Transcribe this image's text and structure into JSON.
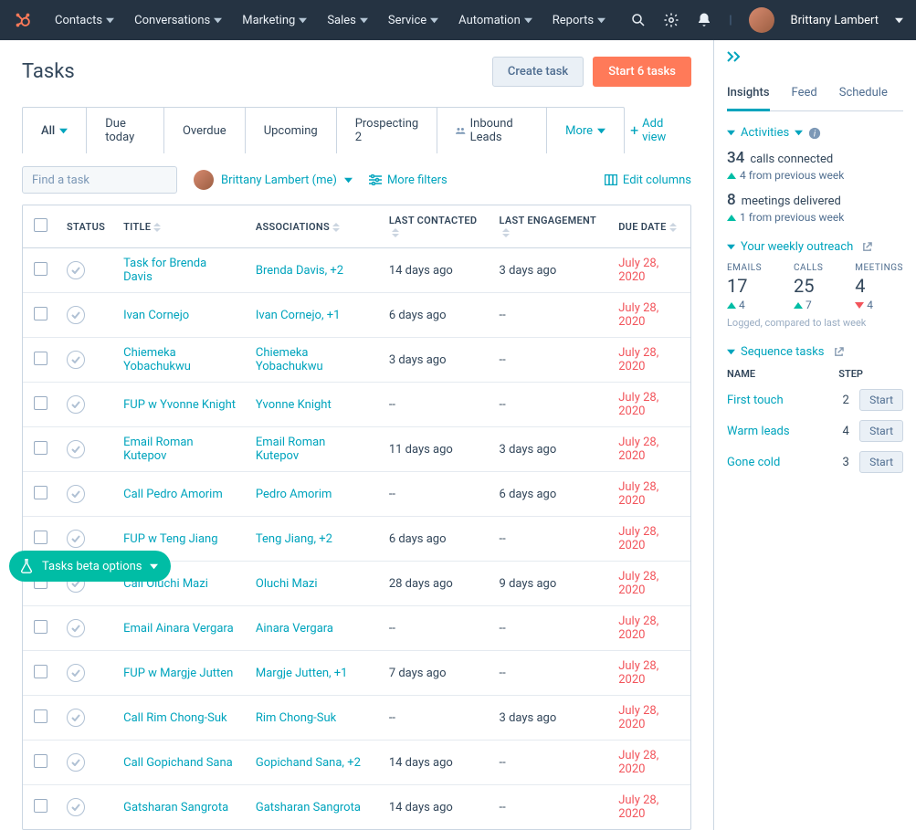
{
  "nav": {
    "items": [
      "Contacts",
      "Conversations",
      "Marketing",
      "Sales",
      "Service",
      "Automation",
      "Reports"
    ],
    "user_name": "Brittany Lambert"
  },
  "page": {
    "title": "Tasks",
    "create_btn": "Create task",
    "start_btn": "Start 6 tasks"
  },
  "tabs": {
    "items": [
      "All",
      "Due today",
      "Overdue",
      "Upcoming",
      "Prospecting 2",
      "Inbound Leads"
    ],
    "more": "More",
    "add_view": "Add view"
  },
  "toolbar": {
    "search_placeholder": "Find a task",
    "owner": "Brittany Lambert (me)",
    "more_filters": "More filters",
    "edit_cols": "Edit columns"
  },
  "table": {
    "headers": {
      "status": "STATUS",
      "title": "TITLE",
      "assoc": "ASSOCIATIONS",
      "lc": "LAST CONTACTED",
      "le": "LAST ENGAGEMENT",
      "due": "DUE DATE"
    },
    "rows": [
      {
        "title": "Task for Brenda Davis",
        "assoc": "Brenda Davis, +2",
        "lc": "14 days ago",
        "le": "3 days ago",
        "due": "July 28, 2020"
      },
      {
        "title": "Ivan Cornejo",
        "assoc": "Ivan Cornejo, +1",
        "lc": "6 days ago",
        "le": "--",
        "due": "July 28, 2020"
      },
      {
        "title": "Chiemeka Yobachukwu",
        "assoc": "Chiemeka Yobachukwu",
        "lc": "3 days ago",
        "le": "--",
        "due": "July 28, 2020"
      },
      {
        "title": "FUP w Yvonne Knight",
        "assoc": "Yvonne Knight",
        "lc": "--",
        "le": "--",
        "due": "July 28, 2020"
      },
      {
        "title": "Email Roman Kutepov",
        "assoc": "Email Roman Kutepov",
        "lc": "11 days ago",
        "le": "3 days ago",
        "due": "July 28, 2020"
      },
      {
        "title": "Call Pedro Amorim",
        "assoc": "Pedro Amorim",
        "lc": "--",
        "le": "6 days ago",
        "due": "July 28, 2020"
      },
      {
        "title": "FUP w Teng Jiang",
        "assoc": "Teng Jiang, +2",
        "lc": "6 days ago",
        "le": "--",
        "due": "July 28, 2020"
      },
      {
        "title": "Call Oluchi Mazi",
        "assoc": "Oluchi Mazi",
        "lc": "28 days ago",
        "le": "9 days ago",
        "due": "July 28, 2020"
      },
      {
        "title": "Email Ainara Vergara",
        "assoc": "Ainara Vergara",
        "lc": "--",
        "le": "--",
        "due": "July 28, 2020"
      },
      {
        "title": "FUP w Margje Jutten",
        "assoc": "Margje Jutten, +1",
        "lc": "7 days ago",
        "le": "--",
        "due": "July 28, 2020"
      },
      {
        "title": "Call Rim Chong-Suk",
        "assoc": "Rim Chong-Suk",
        "lc": "--",
        "le": "3 days ago",
        "due": "July 28, 2020"
      },
      {
        "title": "Call Gopichand Sana",
        "assoc": "Gopichand Sana, +2",
        "lc": "14 days ago",
        "le": "--",
        "due": "July 28, 2020"
      },
      {
        "title": "Gatsharan Sangrota",
        "assoc": "Gatsharan Sangrota",
        "lc": "14 days ago",
        "le": "--",
        "due": "July 28, 2020"
      }
    ]
  },
  "right": {
    "tabs": [
      "Insights",
      "Feed",
      "Schedule"
    ],
    "activities_label": "Activities",
    "calls_num": "34",
    "calls_lbl": "calls connected",
    "calls_delta": "4 from previous week",
    "meet_num": "8",
    "meet_lbl": "meetings delivered",
    "meet_delta": "1 from previous week",
    "outreach_label": "Your weekly outreach",
    "outreach": {
      "emails": {
        "label": "EMAILS",
        "value": "17",
        "delta": "4",
        "dir": "up"
      },
      "calls": {
        "label": "CALLS",
        "value": "25",
        "delta": "7",
        "dir": "up"
      },
      "meetings": {
        "label": "MEETINGS",
        "value": "4",
        "delta": "4",
        "dir": "down"
      }
    },
    "logged_note": "Logged, compared to last week",
    "seq_label": "Sequence tasks",
    "seq_headers": {
      "name": "NAME",
      "step": "STEP"
    },
    "seq_rows": [
      {
        "name": "First touch",
        "step": "2",
        "btn": "Start"
      },
      {
        "name": "Warm leads",
        "step": "4",
        "btn": "Start"
      },
      {
        "name": "Gone cold",
        "step": "3",
        "btn": "Start"
      }
    ]
  },
  "beta": "Tasks beta options"
}
